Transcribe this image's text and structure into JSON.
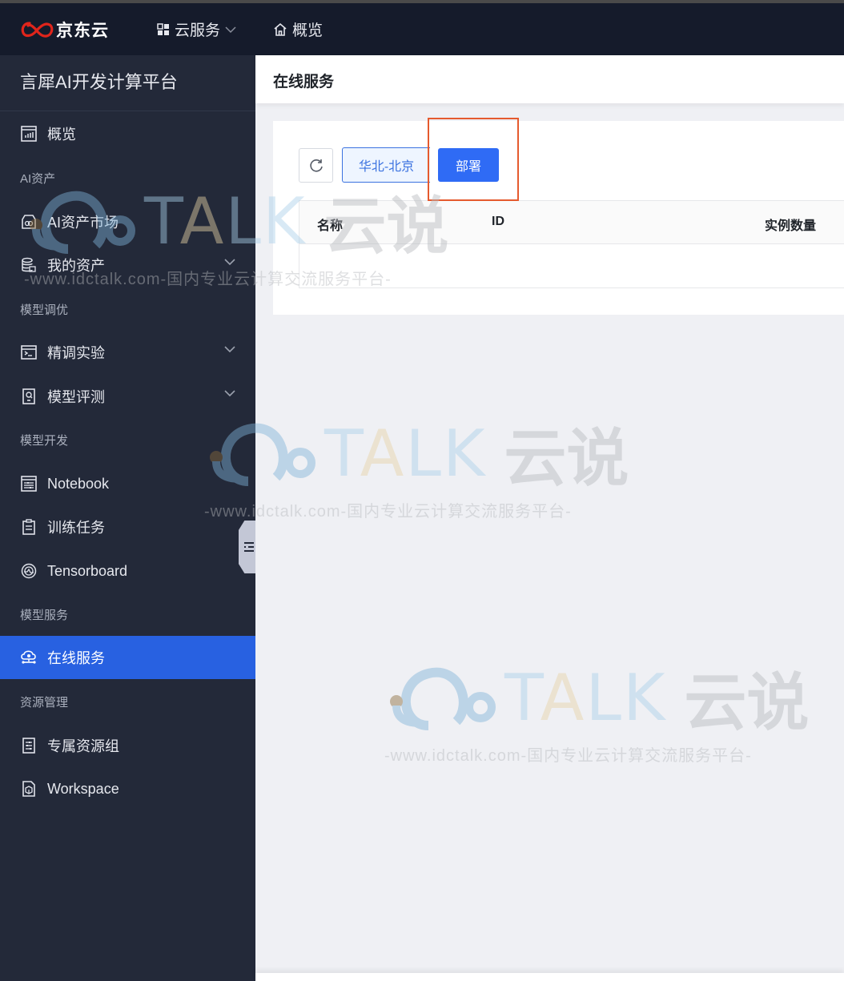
{
  "topbar": {
    "brand": "京东云",
    "brand_color": "#e1251b",
    "services_label": "云服务",
    "overview_label": "概览"
  },
  "sidebar": {
    "title": "言犀AI开发计算平台",
    "groups": [
      {
        "label": "AI资产"
      },
      {
        "label": "模型调优"
      },
      {
        "label": "模型开发"
      },
      {
        "label": "模型服务"
      },
      {
        "label": "资源管理"
      }
    ],
    "items": [
      {
        "label": "概览",
        "icon": "dashboard-icon"
      },
      {
        "label": "AI资产市场",
        "icon": "store-icon"
      },
      {
        "label": "我的资产",
        "icon": "database-icon",
        "expandable": true
      },
      {
        "label": "精调实验",
        "icon": "terminal-icon",
        "expandable": true
      },
      {
        "label": "模型评测",
        "icon": "evaluation-icon",
        "expandable": true
      },
      {
        "label": "Notebook",
        "icon": "notebook-icon"
      },
      {
        "label": "训练任务",
        "icon": "clipboard-icon"
      },
      {
        "label": "Tensorboard",
        "icon": "tensorboard-icon"
      },
      {
        "label": "在线服务",
        "icon": "cloud-service-icon",
        "active": true
      },
      {
        "label": "专属资源组",
        "icon": "resource-group-icon"
      },
      {
        "label": "Workspace",
        "icon": "workspace-icon"
      }
    ],
    "active_color": "#2861e1"
  },
  "main": {
    "page_title": "在线服务",
    "toolbar": {
      "refresh_icon": "refresh-icon",
      "region_label": "华北-北京",
      "deploy_label": "部署"
    },
    "table": {
      "columns": [
        "名称",
        "ID",
        "实例数量"
      ],
      "rows": []
    }
  },
  "watermark": {
    "word": "TALK",
    "word_a": "A",
    "cn": "云说",
    "url": "-www.idctalk.com-国内专业云计算交流服务平台-"
  }
}
